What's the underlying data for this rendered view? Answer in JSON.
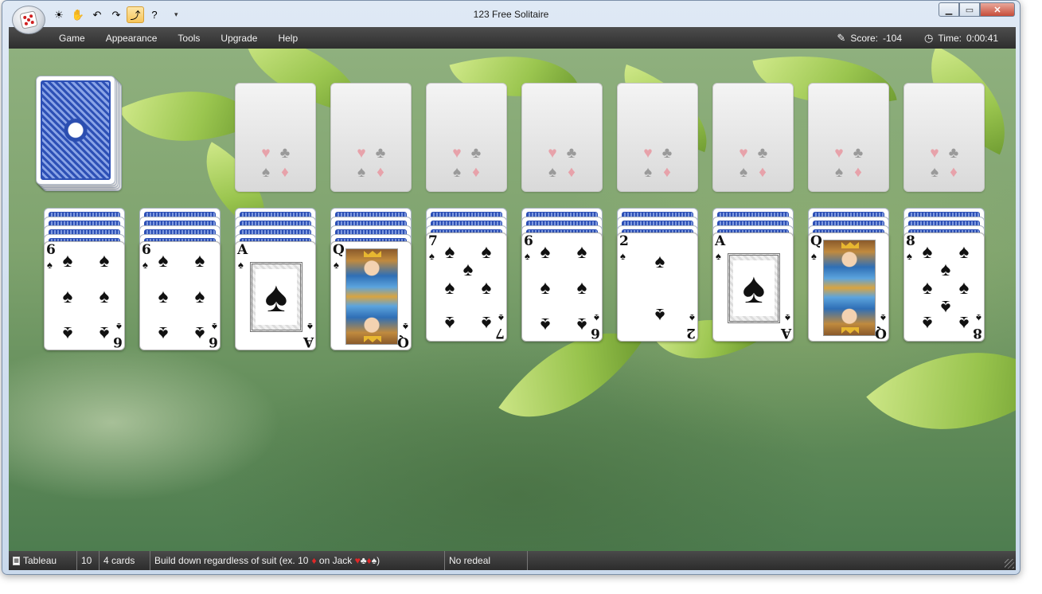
{
  "window": {
    "title": "123 Free Solitaire"
  },
  "quick_access": [
    {
      "name": "new-game-icon",
      "glyph": "☀"
    },
    {
      "name": "hint-icon",
      "glyph": "✋"
    },
    {
      "name": "undo-icon",
      "glyph": "↶"
    },
    {
      "name": "redo-icon",
      "glyph": "↷"
    },
    {
      "name": "autoplay-icon",
      "glyph": "⤴"
    },
    {
      "name": "help-icon",
      "glyph": "?"
    }
  ],
  "menu": {
    "items": [
      "Game",
      "Appearance",
      "Tools",
      "Upgrade",
      "Help"
    ],
    "score_label": "Score:",
    "score_value": "-104",
    "time_label": "Time:",
    "time_value": "0:00:41"
  },
  "foundations_count": 8,
  "foundation_suits": [
    "♥",
    "♣",
    "♠",
    "♦"
  ],
  "tableau": [
    {
      "rank": "6",
      "suit": "♠",
      "hidden": 4
    },
    {
      "rank": "6",
      "suit": "♠",
      "hidden": 4
    },
    {
      "rank": "A",
      "suit": "♠",
      "hidden": 4
    },
    {
      "rank": "Q",
      "suit": "♠",
      "hidden": 4
    },
    {
      "rank": "7",
      "suit": "♠",
      "hidden": 3
    },
    {
      "rank": "6",
      "suit": "♠",
      "hidden": 3
    },
    {
      "rank": "2",
      "suit": "♠",
      "hidden": 3
    },
    {
      "rank": "A",
      "suit": "♠",
      "hidden": 3
    },
    {
      "rank": "Q",
      "suit": "♠",
      "hidden": 3
    },
    {
      "rank": "8",
      "suit": "♠",
      "hidden": 3
    }
  ],
  "status": {
    "pile": "Tableau",
    "count": "10",
    "cards": "4 cards",
    "rule_prefix": "Build down regardless of suit (ex. 10",
    "rule_ten_suit": "♦",
    "rule_mid": " on Jack ",
    "rule_suits": [
      "♥",
      "♣",
      "♦",
      "♠"
    ],
    "rule_suffix": ")",
    "redeal": "No redeal"
  }
}
